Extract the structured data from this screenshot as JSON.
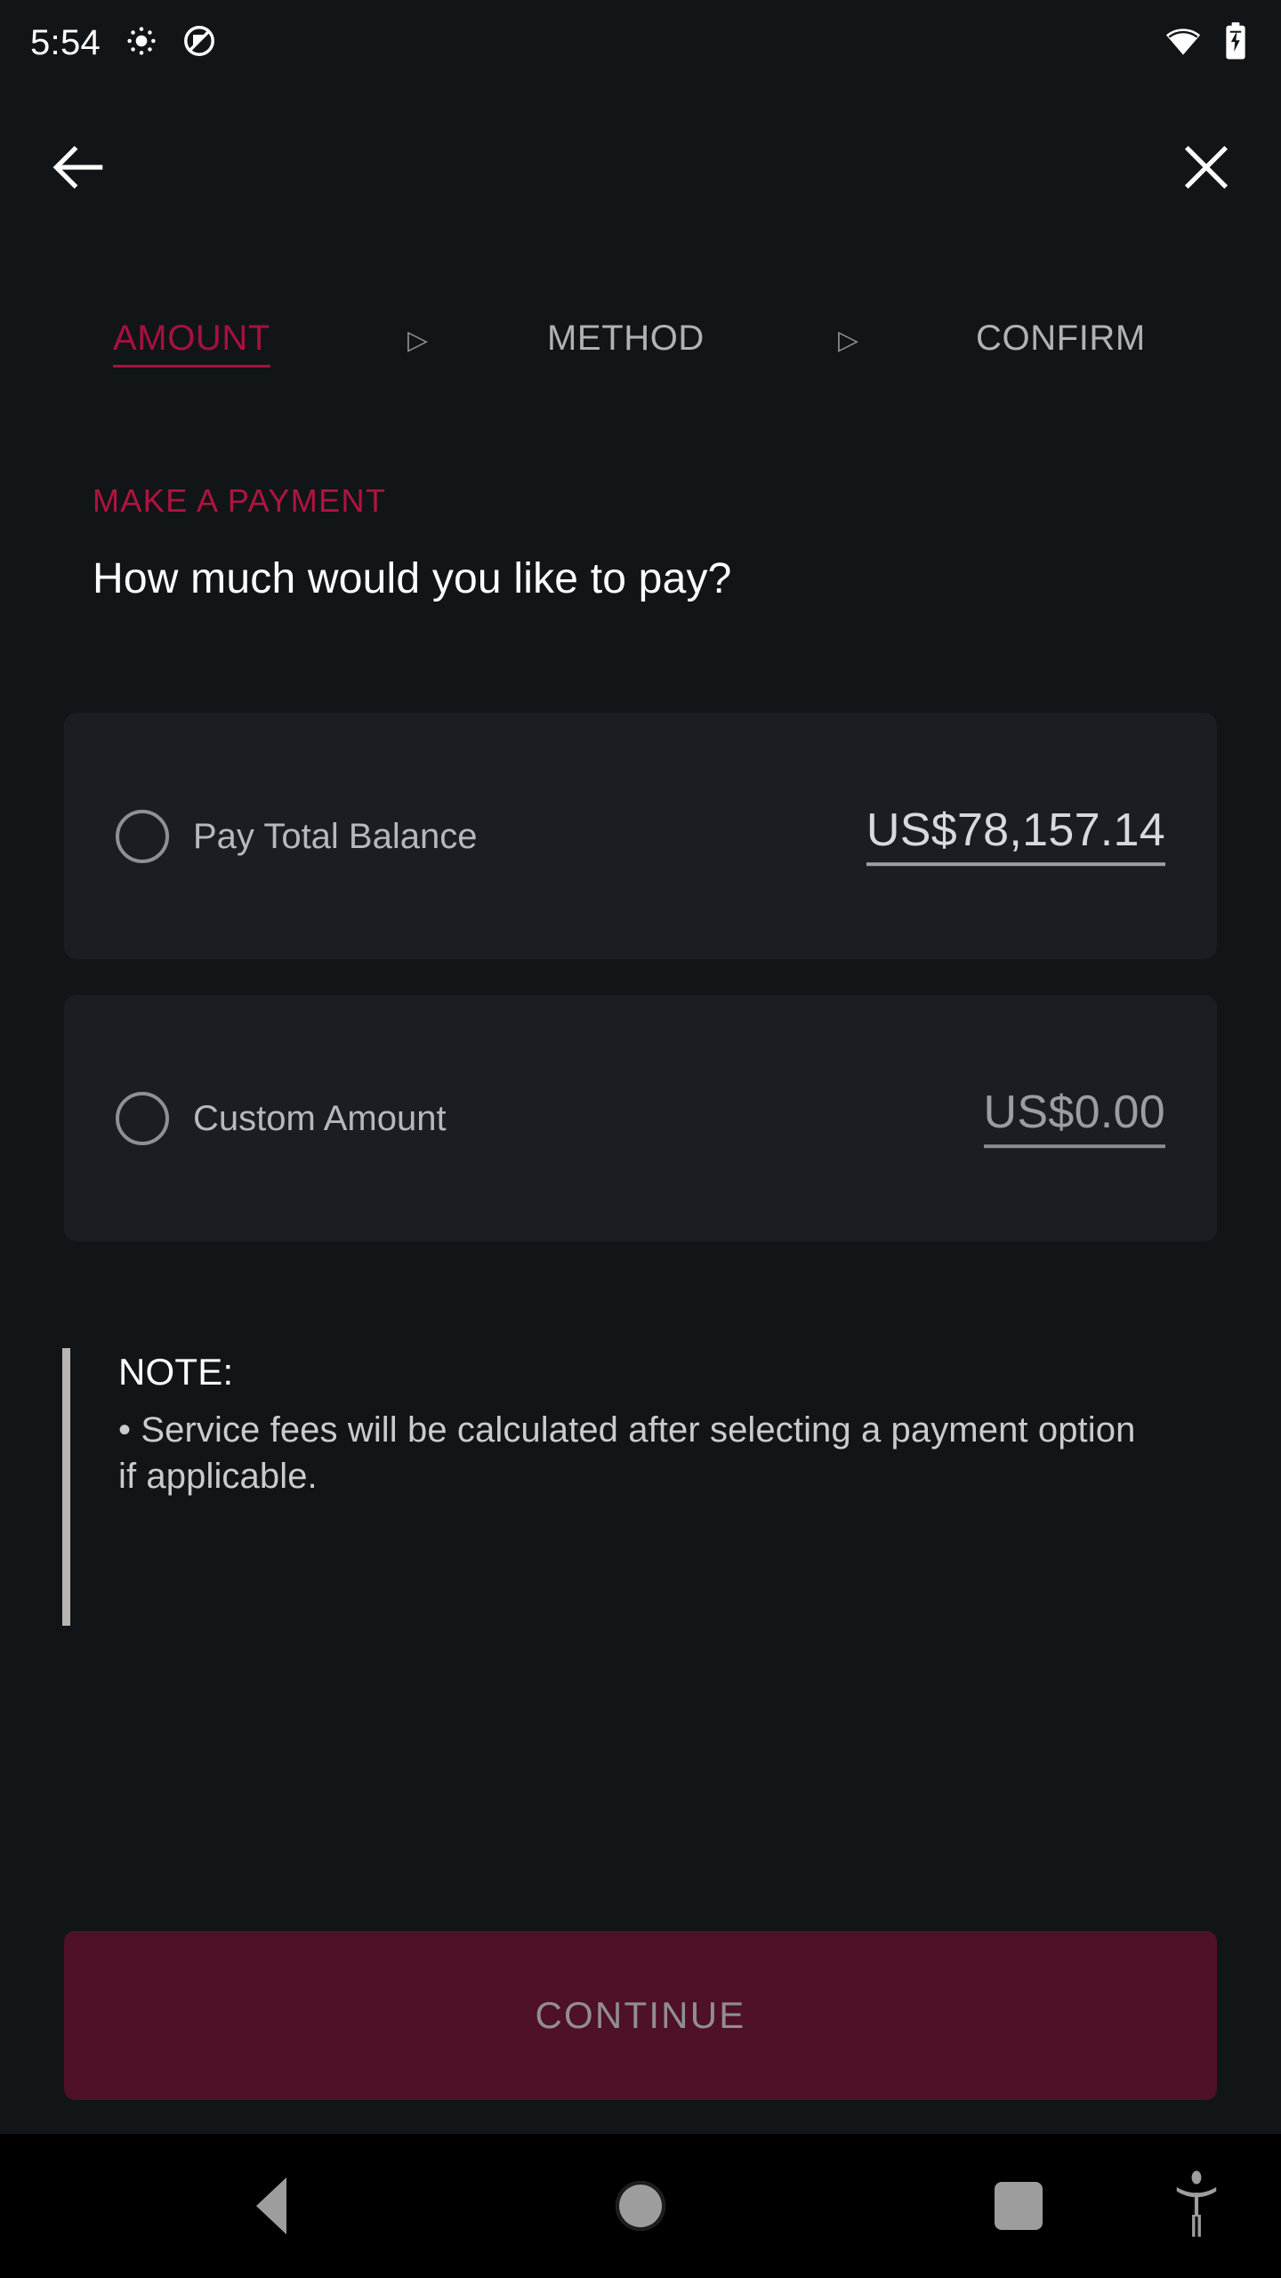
{
  "status_bar": {
    "clock": "5:54",
    "icons": [
      "brightness-icon",
      "do-not-disturb-icon",
      "wifi-icon",
      "battery-charging-icon"
    ]
  },
  "app_bar": {
    "back_icon": "arrow-left-icon",
    "close_icon": "close-icon"
  },
  "stepper": {
    "separator": "▷",
    "steps": [
      {
        "label": "AMOUNT",
        "active": true
      },
      {
        "label": "METHOD",
        "active": false
      },
      {
        "label": "CONFIRM",
        "active": false
      }
    ]
  },
  "section": {
    "eyebrow": "MAKE A PAYMENT",
    "headline": "How much would you like to pay?"
  },
  "options": [
    {
      "id": "pay-total-balance",
      "label": "Pay Total Balance",
      "amount": "US$78,157.14",
      "selected": false,
      "emphasis": "strong"
    },
    {
      "id": "custom-amount",
      "label": "Custom Amount",
      "amount": "US$0.00",
      "placeholder": "US$0.00",
      "selected": false,
      "emphasis": "muted"
    }
  ],
  "note": {
    "title": "NOTE:",
    "text": "• Service fees will be calculated after selecting a payment option if applicable."
  },
  "primary_action": {
    "label": "CONTINUE",
    "enabled": false
  },
  "nav_bar": {
    "back": "triangle-back-icon",
    "home": "circle-home-icon",
    "recents": "square-recents-icon",
    "accessibility": "accessibility-icon"
  },
  "colors": {
    "page_background": "#121517",
    "card_background": "#1a1e22",
    "accent": "#a81040",
    "accent_eyebrow": "#b01440",
    "button_disabled_bg": "#4f1029",
    "button_disabled_text": "#908f8f",
    "text_primary": "#ffffff",
    "text_secondary": "#b6b9bb",
    "nav_bar_background": "#000000"
  }
}
